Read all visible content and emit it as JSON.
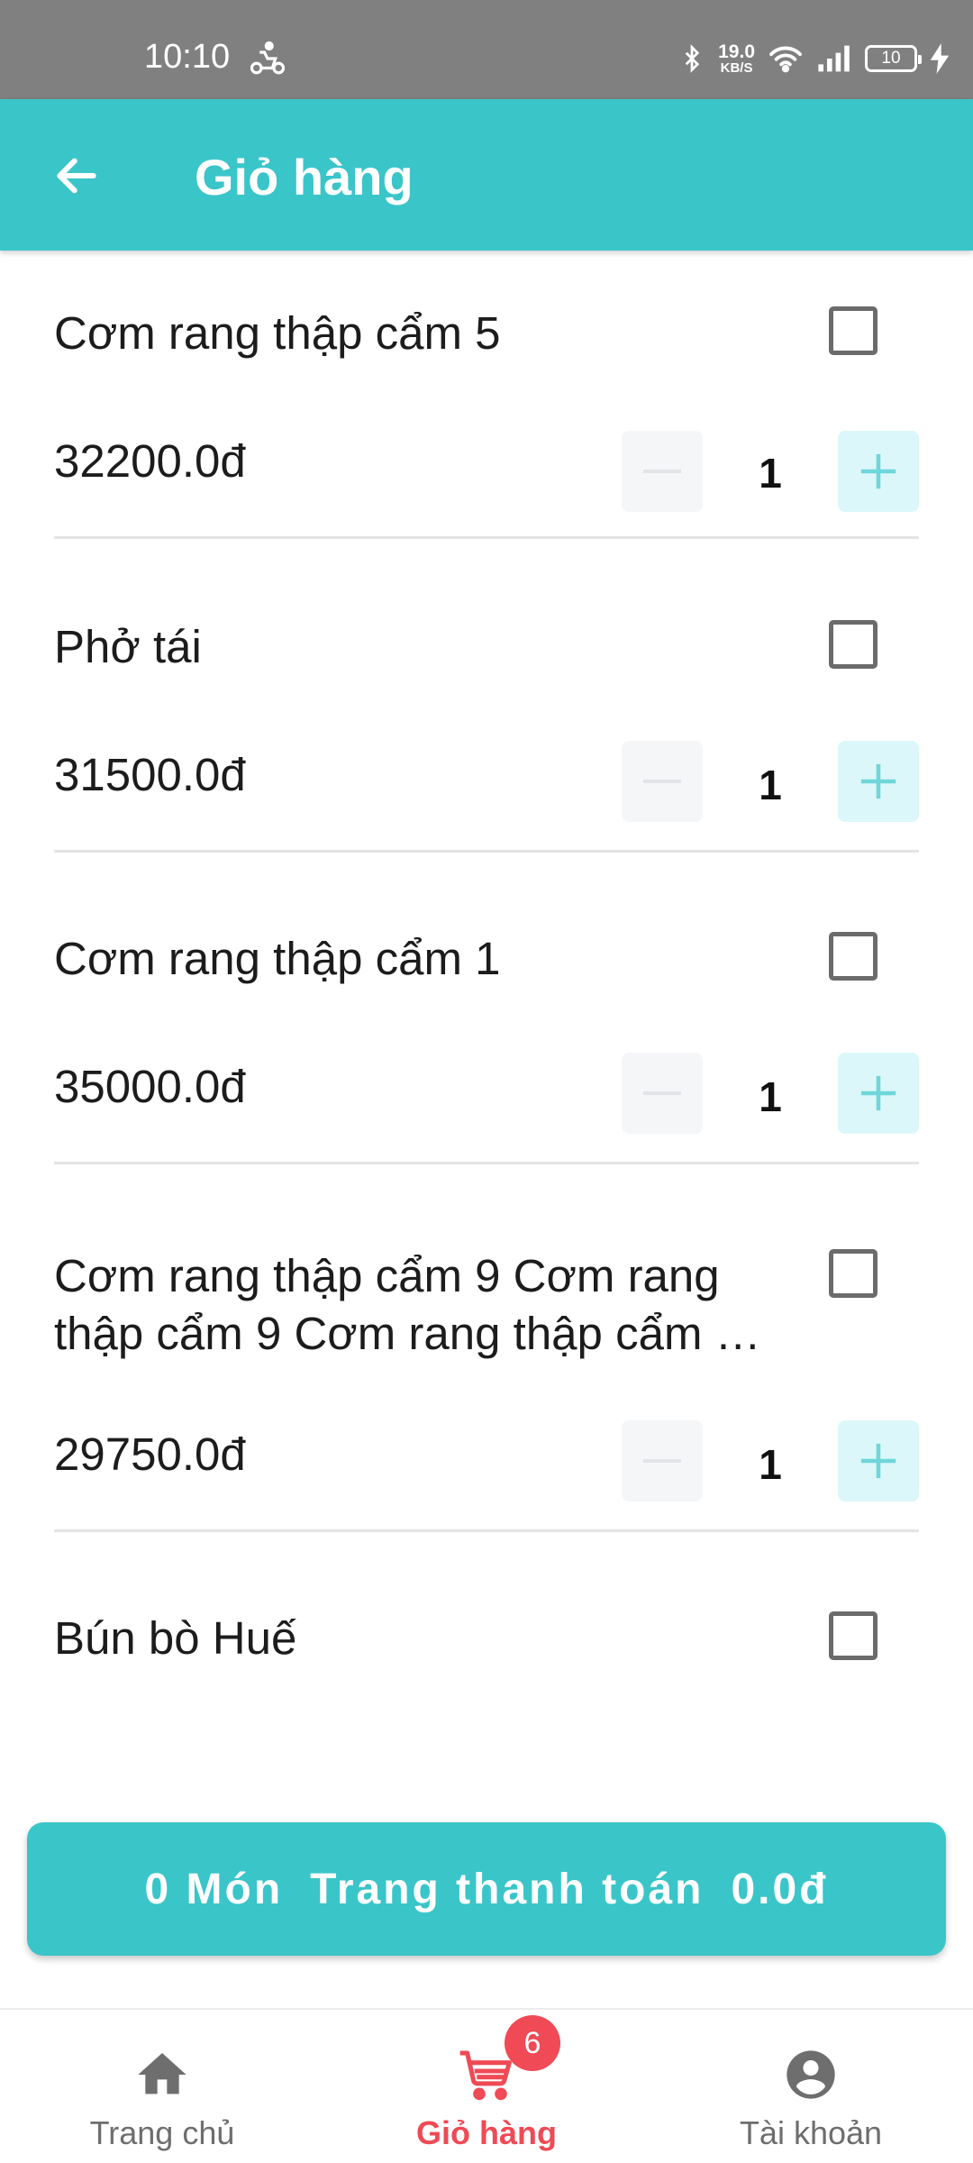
{
  "status_bar": {
    "time": "10:10",
    "net_speed_value": "19.0",
    "net_speed_unit": "KB/S",
    "battery": "10",
    "icons": [
      "delivery-scooter-icon",
      "bluetooth-icon",
      "wifi-icon",
      "signal-icon",
      "battery-icon",
      "charging-icon"
    ]
  },
  "app_bar": {
    "title": "Giỏ hàng",
    "back_icon": "arrow-left-icon"
  },
  "cart": {
    "items": [
      {
        "name": "Cơm rang thập cẩm 5",
        "price": "32200.0đ",
        "quantity": "1",
        "checked": false
      },
      {
        "name": "Phở tái",
        "price": "31500.0đ",
        "quantity": "1",
        "checked": false
      },
      {
        "name": "Cơm rang thập cẩm 1",
        "price": "35000.0đ",
        "quantity": "1",
        "checked": false
      },
      {
        "name": "Cơm rang thập cẩm 9 Cơm rang thập cẩm 9 Cơm rang thập cẩm …",
        "price": "29750.0đ",
        "quantity": "1",
        "checked": false
      },
      {
        "name": "Bún bò Huế",
        "checked": false
      }
    ]
  },
  "checkout": {
    "count_label": "0 Món",
    "action_label": "Trang thanh toán",
    "total": "0.0đ"
  },
  "bottom_nav": {
    "items": [
      {
        "label": "Trang chủ",
        "icon": "home-icon",
        "active": false
      },
      {
        "label": "Giỏ hàng",
        "icon": "cart-icon",
        "active": true,
        "badge": "6"
      },
      {
        "label": "Tài khoản",
        "icon": "account-icon",
        "active": false
      }
    ]
  },
  "colors": {
    "primary": "#3ac5c9",
    "accent": "#ef4a55",
    "status_bar": "#808080"
  }
}
